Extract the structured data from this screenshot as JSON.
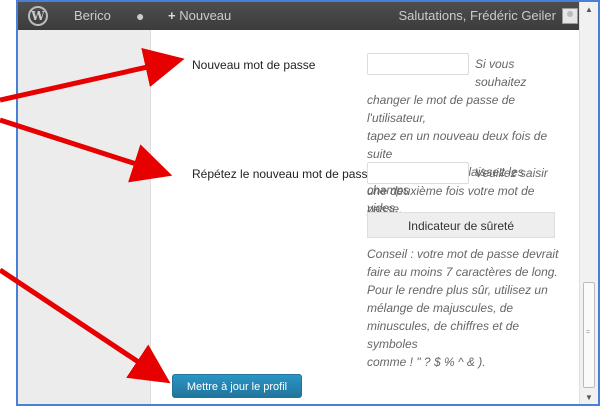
{
  "adminbar": {
    "site_name": "Berico",
    "new_label": "Nouveau",
    "greeting": "Salutations, Frédéric Geiler"
  },
  "form": {
    "new_password_label": "Nouveau mot de passe",
    "new_password_hint": [
      "Si vous souhaitez",
      "changer le mot de passe de l'utilisateur,",
      "tapez en un nouveau deux fois de suite",
      "ci-dessous. Sinon, laissez les champs",
      "vides."
    ],
    "repeat_password_label": "Répétez le nouveau mot de passe",
    "repeat_password_hint": [
      "Veuillez saisir",
      "une deuxième fois votre mot de passe."
    ],
    "strength_indicator": "Indicateur de sûreté",
    "advice": [
      "Conseil : votre mot de passe devrait",
      "faire au moins 7 caractères de long.",
      "Pour le rendre plus sûr, utilisez un",
      "mélange de majuscules, de",
      "minuscules, de chiffres et de symboles",
      "comme ! \" ? $ % ^ & )."
    ],
    "update_button": "Mettre à jour le profil"
  },
  "colors": {
    "adminbar_bg": "#464646",
    "annotation_arrow": "#e60000",
    "button_blue": "#21759b",
    "frame_border": "#4a7fd4"
  }
}
